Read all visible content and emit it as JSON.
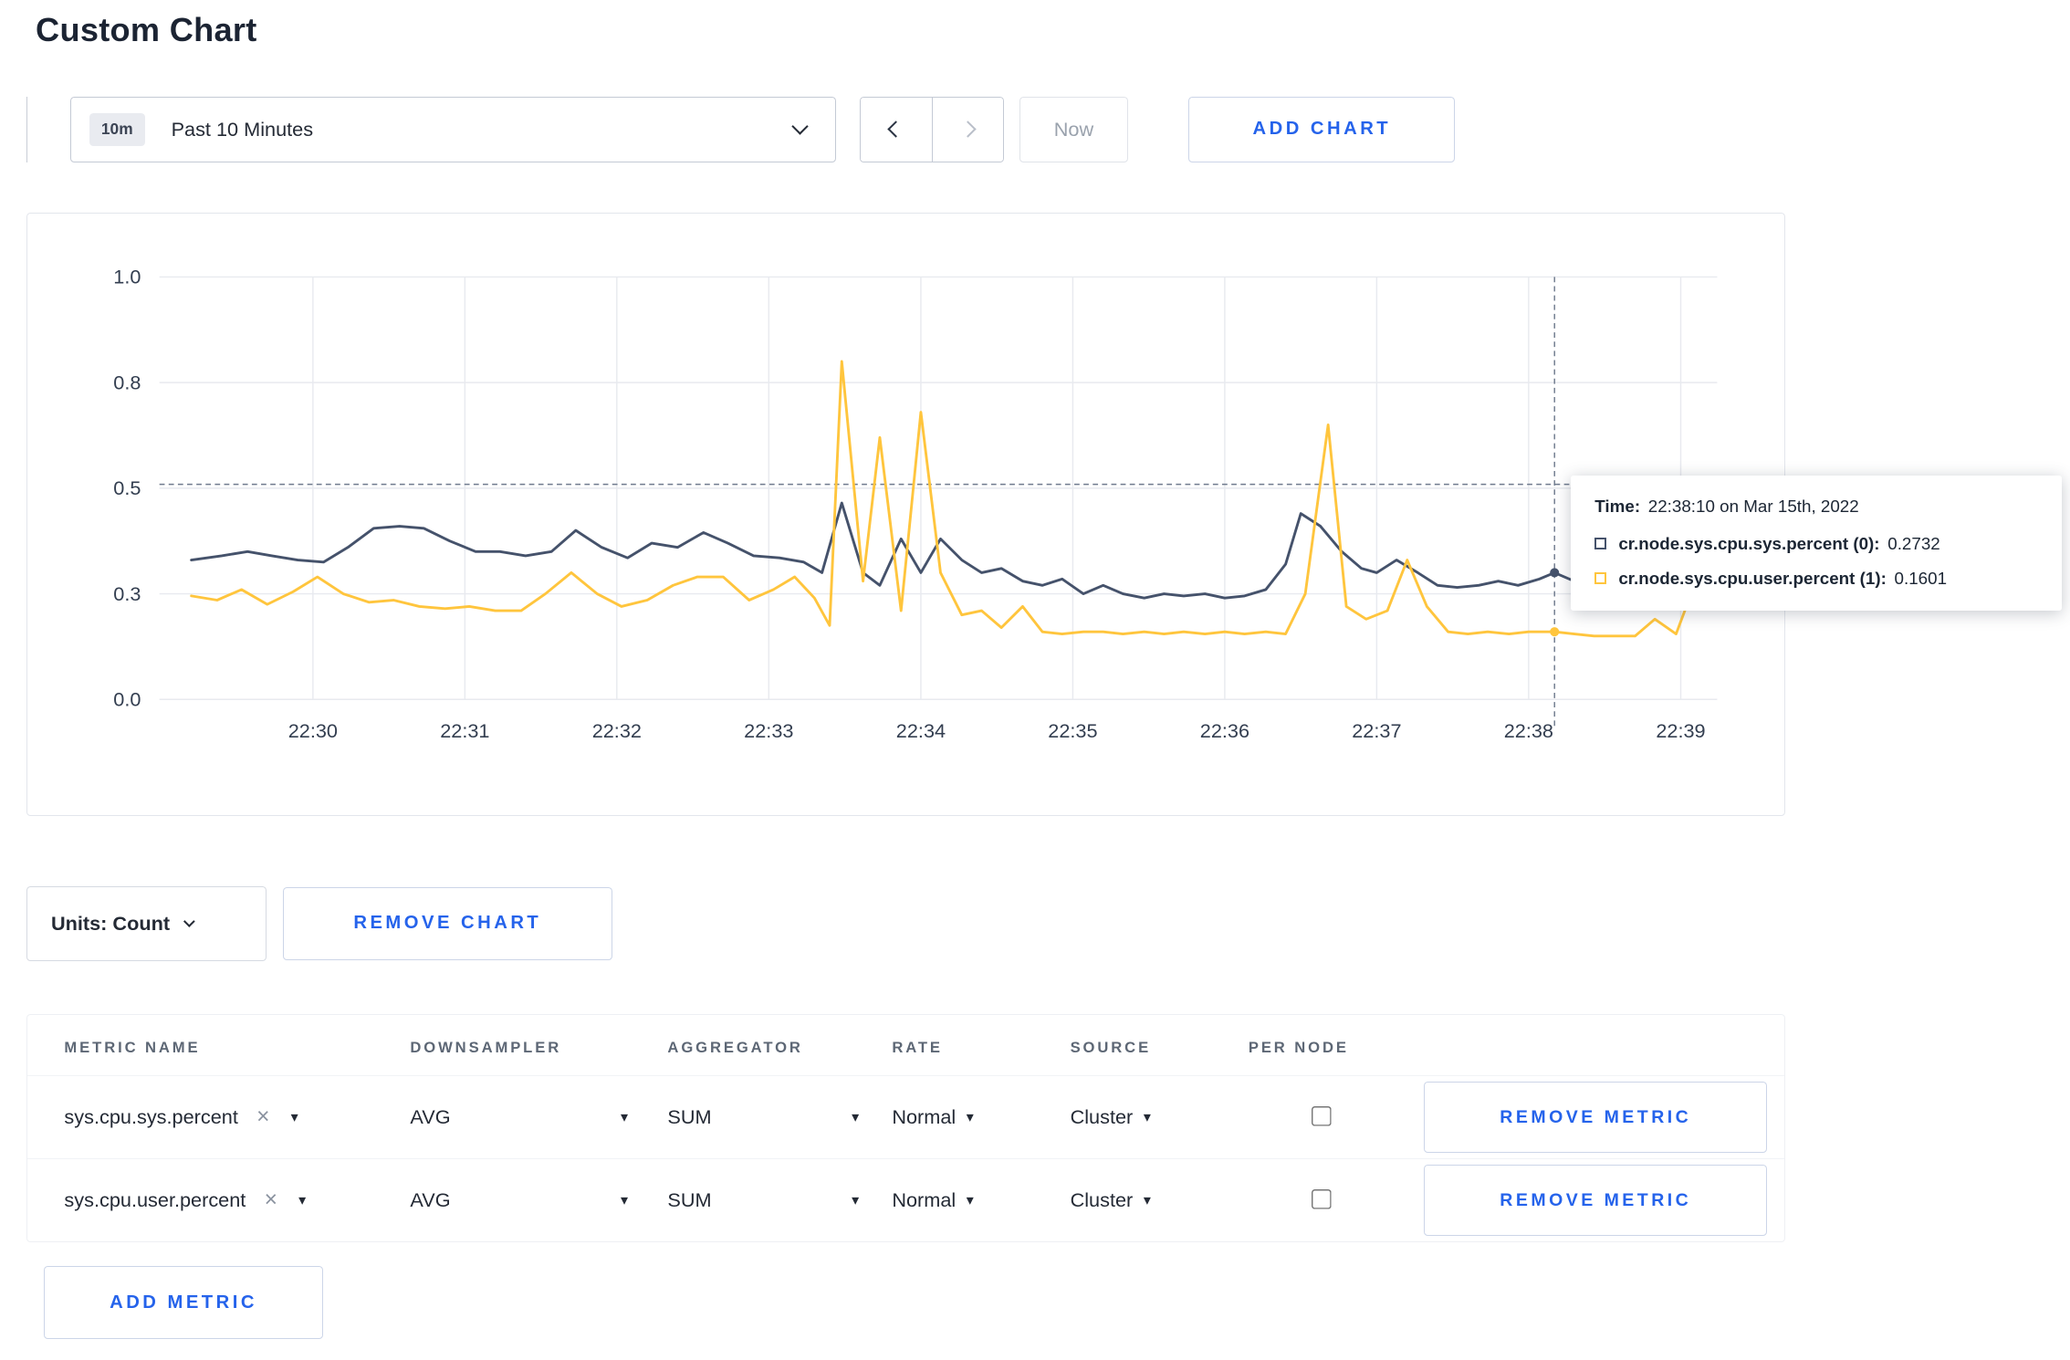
{
  "page": {
    "title": "Custom Chart"
  },
  "colors": {
    "accent_blue": "#2563eb",
    "series_sys": "#45526b",
    "series_user": "#ffc53d",
    "grid": "#e8eaef"
  },
  "icons": {
    "close": "×",
    "caret": "▾",
    "chevron_down": "chevron-down",
    "chevron_left": "chevron-left",
    "chevron_right": "chevron-right"
  },
  "toolbar": {
    "time_badge": "10m",
    "time_label": "Past 10 Minutes",
    "now_label": "Now",
    "add_chart_label": "ADD CHART"
  },
  "chart_data": {
    "type": "line",
    "title": "",
    "xlabel": "",
    "ylabel": "",
    "x_domain": [
      28.99,
      39.24
    ],
    "y_domain": [
      0,
      1
    ],
    "legend_position": "none",
    "grid": true,
    "x_ticks": [
      {
        "t": 30,
        "label": "22:30"
      },
      {
        "t": 31,
        "label": "22:31"
      },
      {
        "t": 32,
        "label": "22:32"
      },
      {
        "t": 33,
        "label": "22:33"
      },
      {
        "t": 34,
        "label": "22:34"
      },
      {
        "t": 35,
        "label": "22:35"
      },
      {
        "t": 36,
        "label": "22:36"
      },
      {
        "t": 37,
        "label": "22:37"
      },
      {
        "t": 38,
        "label": "22:38"
      },
      {
        "t": 39,
        "label": "22:39"
      }
    ],
    "y_ticks": [
      {
        "v": 0,
        "label": "0.0"
      },
      {
        "v": 0.25,
        "label": "0.3"
      },
      {
        "v": 0.5,
        "label": "0.5"
      },
      {
        "v": 0.75,
        "label": "0.8"
      },
      {
        "v": 1,
        "label": "1.0"
      }
    ],
    "crosshair": {
      "t": 38.17,
      "hline_value": 0.509,
      "markers": [
        {
          "series": 0,
          "t": 38.17,
          "v": 0.3
        },
        {
          "series": 1,
          "t": 38.17,
          "v": 0.16
        }
      ]
    },
    "series": [
      {
        "name": "cr.node.sys.cpu.sys.percent",
        "color": "#45526b",
        "points": [
          [
            29.2,
            0.33
          ],
          [
            29.4,
            0.34
          ],
          [
            29.57,
            0.35
          ],
          [
            29.73,
            0.34
          ],
          [
            29.9,
            0.33
          ],
          [
            30.07,
            0.325
          ],
          [
            30.23,
            0.36
          ],
          [
            30.4,
            0.405
          ],
          [
            30.57,
            0.41
          ],
          [
            30.73,
            0.405
          ],
          [
            30.9,
            0.375
          ],
          [
            31.07,
            0.35
          ],
          [
            31.23,
            0.35
          ],
          [
            31.4,
            0.34
          ],
          [
            31.57,
            0.35
          ],
          [
            31.73,
            0.4
          ],
          [
            31.9,
            0.36
          ],
          [
            32.07,
            0.335
          ],
          [
            32.23,
            0.37
          ],
          [
            32.4,
            0.36
          ],
          [
            32.57,
            0.395
          ],
          [
            32.73,
            0.37
          ],
          [
            32.9,
            0.34
          ],
          [
            33.07,
            0.335
          ],
          [
            33.23,
            0.325
          ],
          [
            33.35,
            0.3
          ],
          [
            33.48,
            0.465
          ],
          [
            33.62,
            0.3
          ],
          [
            33.73,
            0.27
          ],
          [
            33.87,
            0.38
          ],
          [
            34.0,
            0.3
          ],
          [
            34.13,
            0.38
          ],
          [
            34.27,
            0.33
          ],
          [
            34.4,
            0.3
          ],
          [
            34.53,
            0.31
          ],
          [
            34.67,
            0.28
          ],
          [
            34.8,
            0.27
          ],
          [
            34.93,
            0.285
          ],
          [
            35.07,
            0.25
          ],
          [
            35.2,
            0.27
          ],
          [
            35.33,
            0.25
          ],
          [
            35.47,
            0.24
          ],
          [
            35.6,
            0.25
          ],
          [
            35.73,
            0.245
          ],
          [
            35.87,
            0.25
          ],
          [
            36.0,
            0.24
          ],
          [
            36.13,
            0.245
          ],
          [
            36.27,
            0.26
          ],
          [
            36.4,
            0.32
          ],
          [
            36.5,
            0.44
          ],
          [
            36.63,
            0.41
          ],
          [
            36.77,
            0.35
          ],
          [
            36.9,
            0.31
          ],
          [
            37.0,
            0.3
          ],
          [
            37.13,
            0.33
          ],
          [
            37.27,
            0.3
          ],
          [
            37.4,
            0.27
          ],
          [
            37.53,
            0.265
          ],
          [
            37.67,
            0.27
          ],
          [
            37.8,
            0.28
          ],
          [
            37.93,
            0.27
          ],
          [
            38.07,
            0.285
          ],
          [
            38.17,
            0.3
          ],
          [
            38.3,
            0.28
          ],
          [
            38.43,
            0.295
          ],
          [
            38.57,
            0.31
          ],
          [
            38.7,
            0.3
          ],
          [
            38.83,
            0.295
          ],
          [
            38.97,
            0.3
          ],
          [
            39.1,
            0.305
          ],
          [
            39.2,
            0.3
          ]
        ]
      },
      {
        "name": "cr.node.sys.cpu.user.percent",
        "color": "#ffc53d",
        "points": [
          [
            29.2,
            0.245
          ],
          [
            29.37,
            0.235
          ],
          [
            29.53,
            0.26
          ],
          [
            29.7,
            0.225
          ],
          [
            29.87,
            0.255
          ],
          [
            30.03,
            0.29
          ],
          [
            30.2,
            0.25
          ],
          [
            30.37,
            0.23
          ],
          [
            30.53,
            0.235
          ],
          [
            30.7,
            0.22
          ],
          [
            30.87,
            0.215
          ],
          [
            31.03,
            0.22
          ],
          [
            31.2,
            0.21
          ],
          [
            31.37,
            0.21
          ],
          [
            31.53,
            0.25
          ],
          [
            31.7,
            0.3
          ],
          [
            31.87,
            0.25
          ],
          [
            32.03,
            0.22
          ],
          [
            32.2,
            0.235
          ],
          [
            32.37,
            0.27
          ],
          [
            32.53,
            0.29
          ],
          [
            32.7,
            0.29
          ],
          [
            32.87,
            0.235
          ],
          [
            33.03,
            0.26
          ],
          [
            33.17,
            0.29
          ],
          [
            33.3,
            0.24
          ],
          [
            33.4,
            0.175
          ],
          [
            33.48,
            0.8
          ],
          [
            33.62,
            0.28
          ],
          [
            33.73,
            0.62
          ],
          [
            33.87,
            0.21
          ],
          [
            34.0,
            0.68
          ],
          [
            34.13,
            0.3
          ],
          [
            34.27,
            0.2
          ],
          [
            34.4,
            0.21
          ],
          [
            34.53,
            0.17
          ],
          [
            34.67,
            0.22
          ],
          [
            34.8,
            0.16
          ],
          [
            34.93,
            0.155
          ],
          [
            35.07,
            0.16
          ],
          [
            35.2,
            0.16
          ],
          [
            35.33,
            0.155
          ],
          [
            35.47,
            0.16
          ],
          [
            35.6,
            0.155
          ],
          [
            35.73,
            0.16
          ],
          [
            35.87,
            0.155
          ],
          [
            36.0,
            0.16
          ],
          [
            36.13,
            0.155
          ],
          [
            36.27,
            0.16
          ],
          [
            36.4,
            0.155
          ],
          [
            36.53,
            0.25
          ],
          [
            36.68,
            0.65
          ],
          [
            36.8,
            0.22
          ],
          [
            36.93,
            0.19
          ],
          [
            37.07,
            0.21
          ],
          [
            37.2,
            0.33
          ],
          [
            37.33,
            0.22
          ],
          [
            37.47,
            0.16
          ],
          [
            37.6,
            0.155
          ],
          [
            37.73,
            0.16
          ],
          [
            37.87,
            0.155
          ],
          [
            38.0,
            0.16
          ],
          [
            38.17,
            0.16
          ],
          [
            38.3,
            0.155
          ],
          [
            38.43,
            0.15
          ],
          [
            38.57,
            0.15
          ],
          [
            38.7,
            0.15
          ],
          [
            38.83,
            0.19
          ],
          [
            38.97,
            0.155
          ],
          [
            39.1,
            0.28
          ],
          [
            39.2,
            0.24
          ]
        ]
      }
    ]
  },
  "tooltip": {
    "time_label": "Time:",
    "time_value": "22:38:10 on Mar 15th, 2022",
    "rows": [
      {
        "label": "cr.node.sys.cpu.sys.percent (0):",
        "value": "0.2732",
        "color": "#45526b"
      },
      {
        "label": "cr.node.sys.cpu.user.percent (1):",
        "value": "0.1601",
        "color": "#ffc53d"
      }
    ]
  },
  "controls": {
    "units_label": "Units: Count",
    "remove_chart_label": "REMOVE CHART",
    "add_metric_label": "ADD METRIC"
  },
  "table": {
    "headers": [
      "METRIC NAME",
      "DOWNSAMPLER",
      "AGGREGATOR",
      "RATE",
      "SOURCE",
      "PER NODE"
    ],
    "rows": [
      {
        "metric": "sys.cpu.sys.percent",
        "downsampler": "AVG",
        "aggregator": "SUM",
        "rate": "Normal",
        "source": "Cluster",
        "per_node": false,
        "remove_label": "REMOVE METRIC"
      },
      {
        "metric": "sys.cpu.user.percent",
        "downsampler": "AVG",
        "aggregator": "SUM",
        "rate": "Normal",
        "source": "Cluster",
        "per_node": false,
        "remove_label": "REMOVE METRIC"
      }
    ]
  }
}
